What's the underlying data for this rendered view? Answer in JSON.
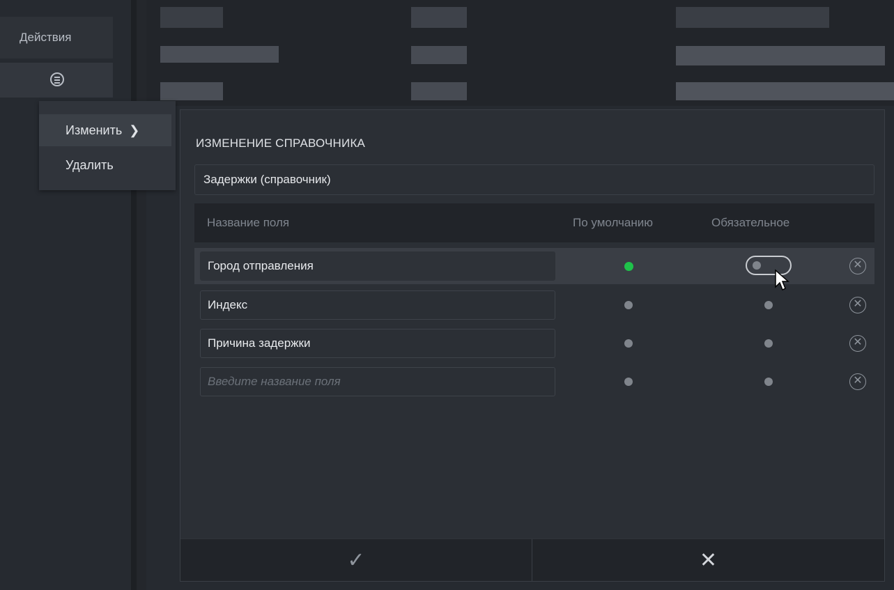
{
  "sidebar": {
    "actions_header": "Действия",
    "row_menu_icon": "list-circle-icon"
  },
  "context_menu": {
    "items": [
      {
        "label": "Изменить",
        "icon": "chevron-right-icon"
      },
      {
        "label": "Удалить"
      }
    ]
  },
  "dialog": {
    "title": "ИЗМЕНЕНИЕ СПРАВОЧНИКА",
    "name_value": "Задержки (справочник)",
    "columns": {
      "name": "Название поля",
      "default": "По умолчанию",
      "required": "Обязательное"
    },
    "rows": [
      {
        "name": "Город отправления",
        "default": true,
        "required": false,
        "required_control": "toggle",
        "highlighted": true
      },
      {
        "name": "Индекс",
        "default": false,
        "required": false
      },
      {
        "name": "Причина задержки",
        "default": false,
        "required": false
      }
    ],
    "new_field_placeholder": "Введите название поля",
    "footer": {
      "confirm_icon": "check-icon",
      "cancel_icon": "close-icon"
    }
  },
  "colors": {
    "background": "#262a30",
    "dialog": "#2b2f35",
    "active_dot": "#1fc24a",
    "inactive_dot": "#80858c"
  }
}
